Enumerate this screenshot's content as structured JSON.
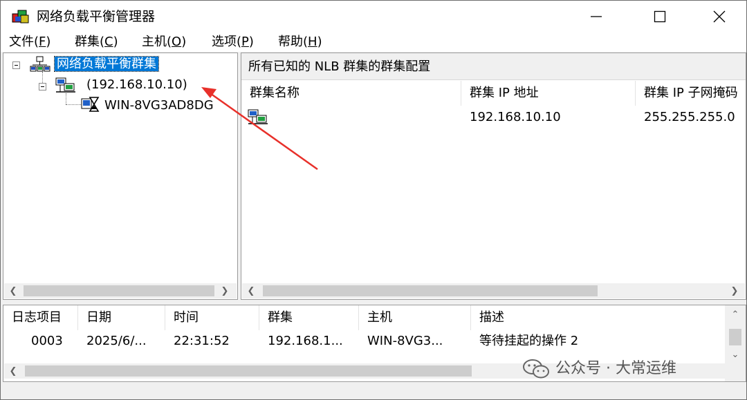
{
  "window": {
    "title": "网络负载平衡管理器"
  },
  "menu": [
    {
      "label": "文件(",
      "key": "F",
      "tail": ")"
    },
    {
      "label": "群集(",
      "key": "C",
      "tail": ")"
    },
    {
      "label": "主机(",
      "key": "O",
      "tail": ")"
    },
    {
      "label": "选项(",
      "key": "P",
      "tail": ")"
    },
    {
      "label": "帮助(",
      "key": "H",
      "tail": ")"
    }
  ],
  "tree": {
    "root": "网络负载平衡群集",
    "cluster": "(192.168.10.10)",
    "host": "WIN-8VG3AD8DG"
  },
  "right_pane": {
    "title": "所有已知的 NLB 群集的群集配置",
    "columns": [
      "群集名称",
      "群集 IP 地址",
      "群集 IP 子网掩码"
    ],
    "rows": [
      {
        "name": "",
        "ip": "192.168.10.10",
        "mask": "255.255.255.0"
      }
    ]
  },
  "log": {
    "columns": [
      "日志项目",
      "日期",
      "时间",
      "群集",
      "主机",
      "描述"
    ],
    "rows": [
      {
        "item": "0003",
        "date": "2025/6/...",
        "time": "22:31:52",
        "cluster": "192.168.1...",
        "host": "WIN-8VG3...",
        "desc": "等待挂起的操作 2"
      }
    ]
  },
  "watermark": "公众号 · 大常运维",
  "colors": {
    "selection": "#0078d7",
    "annotation_arrow": "#e8302a"
  }
}
